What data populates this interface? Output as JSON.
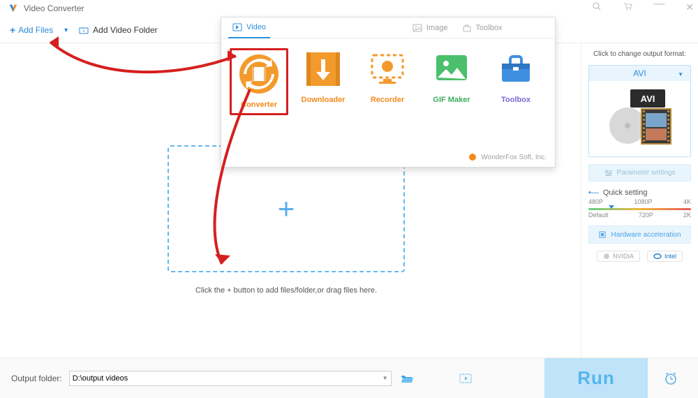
{
  "title": "Video Converter",
  "toolbar": {
    "add_files": "Add Files",
    "add_folder": "Add Video Folder"
  },
  "panel": {
    "tabs": {
      "video": "Video",
      "image": "Image",
      "toolbox": "Toolbox"
    },
    "items": {
      "converter": "Converter",
      "downloader": "Downloader",
      "recorder": "Recorder",
      "gif": "GIF Maker",
      "toolbox": "Toolbox"
    },
    "footer": "WonderFox Soft, Inc."
  },
  "drop_hint": "Click the + button to add files/folder,or drag files here.",
  "sidebar": {
    "format_hint": "Click to change output format:",
    "format": "AVI",
    "format_badge": "AVI",
    "parameter": "Parameter settings",
    "quick_setting": "Quick setting",
    "marks": {
      "m480": "480P",
      "m1080": "1080P",
      "m4k": "4K",
      "def": "Default",
      "m720": "720P",
      "m2k": "2K"
    },
    "hw": "Hardware acceleration",
    "nvidia": "NVIDIA",
    "intel": "Intel"
  },
  "bottom": {
    "label": "Output folder:",
    "path": "D:\\output videos",
    "run": "Run"
  }
}
